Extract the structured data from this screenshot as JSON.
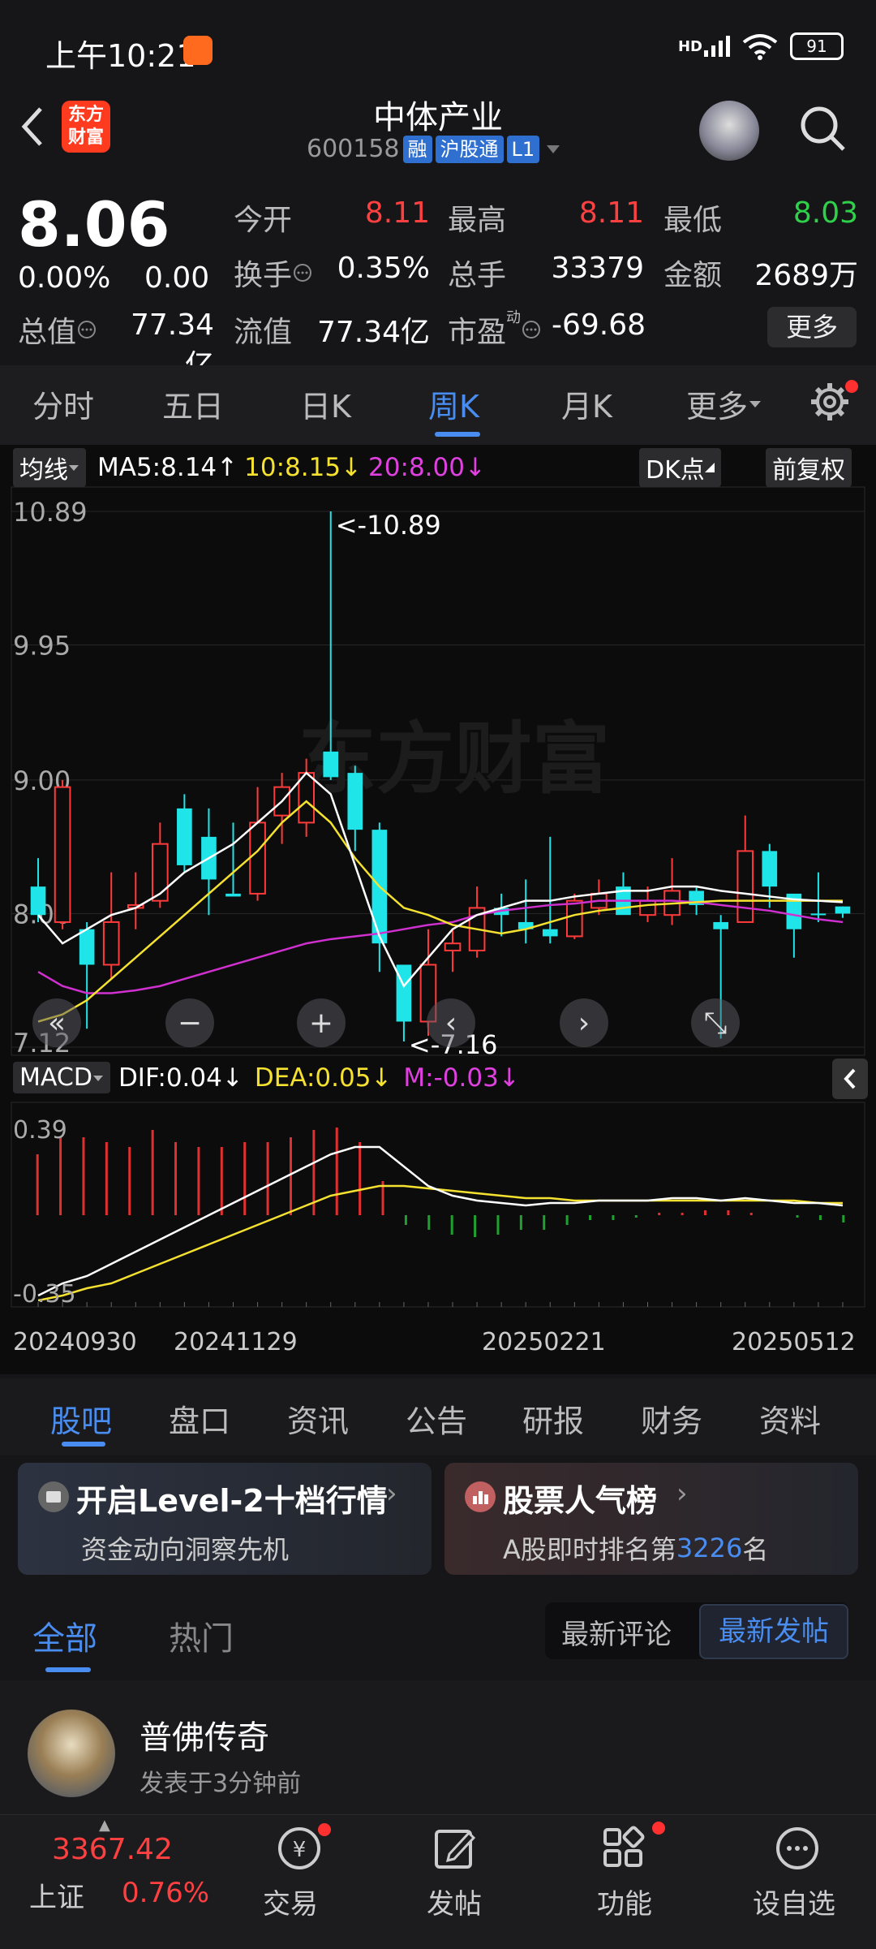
{
  "status": {
    "time": "上午10:21",
    "network": "HD",
    "battery": "91"
  },
  "header": {
    "logo_top": "东方",
    "logo_bottom": "财富",
    "title": "中体产业",
    "code": "600158",
    "tags": [
      "融",
      "沪股通",
      "L1"
    ]
  },
  "quote": {
    "price": "8.06",
    "change_pct": "0.00%",
    "change_val": "0.00",
    "open_label": "今开",
    "open": "8.11",
    "high_label": "最高",
    "high": "8.11",
    "low_label": "最低",
    "low": "8.03",
    "turnover_label": "换手",
    "turnover": "0.35%",
    "volume_label": "总手",
    "volume": "33379",
    "amount_label": "金额",
    "amount": "2689万",
    "mktcap_label": "总值",
    "mktcap": "77.34亿",
    "float_label": "流值",
    "float": "77.34亿",
    "pe_label": "市盈",
    "pe_sup": "动",
    "pe": "-69.68",
    "more": "更多"
  },
  "chart_tabs": [
    "分时",
    "五日",
    "日K",
    "周K",
    "月K",
    "更多"
  ],
  "ma_bar": {
    "selector": "均线",
    "ma5": "MA5:8.14",
    "ma10": "10:8.15",
    "ma20": "20:8.00",
    "dk": "DK点",
    "adjust": "前复权"
  },
  "chart_data": {
    "type": "candlestick",
    "price_axis_labels": [
      "10.89",
      "9.95",
      "9.00",
      "8.06",
      "7.12"
    ],
    "ylim": [
      7.12,
      10.89
    ],
    "annotations": [
      "<-10.89",
      "<-7.16"
    ],
    "watermark": "东方财富",
    "x_labels": [
      "20240930",
      "20241129",
      "20250221",
      "20250512"
    ],
    "candles": [
      {
        "o": 8.25,
        "h": 8.45,
        "l": 8.0,
        "c": 8.05
      },
      {
        "o": 8.0,
        "h": 9.0,
        "l": 7.95,
        "c": 8.95
      },
      {
        "o": 7.95,
        "h": 8.0,
        "l": 7.25,
        "c": 7.7
      },
      {
        "o": 7.7,
        "h": 8.35,
        "l": 7.6,
        "c": 8.0
      },
      {
        "o": 8.1,
        "h": 8.35,
        "l": 7.95,
        "c": 8.12
      },
      {
        "o": 8.15,
        "h": 8.7,
        "l": 8.1,
        "c": 8.55
      },
      {
        "o": 8.8,
        "h": 8.9,
        "l": 8.35,
        "c": 8.4
      },
      {
        "o": 8.6,
        "h": 8.8,
        "l": 8.05,
        "c": 8.3
      },
      {
        "o": 8.2,
        "h": 8.7,
        "l": 8.2,
        "c": 8.18
      },
      {
        "o": 8.2,
        "h": 8.95,
        "l": 8.15,
        "c": 8.7
      },
      {
        "o": 8.75,
        "h": 9.05,
        "l": 8.55,
        "c": 8.95
      },
      {
        "o": 8.7,
        "h": 9.15,
        "l": 8.6,
        "c": 9.05
      },
      {
        "o": 9.2,
        "h": 10.89,
        "l": 9.0,
        "c": 9.02
      },
      {
        "o": 9.05,
        "h": 9.1,
        "l": 8.5,
        "c": 8.65
      },
      {
        "o": 8.65,
        "h": 8.7,
        "l": 7.65,
        "c": 7.85
      },
      {
        "o": 7.7,
        "h": 7.7,
        "l": 7.16,
        "c": 7.3
      },
      {
        "o": 7.3,
        "h": 7.95,
        "l": 7.2,
        "c": 7.7
      },
      {
        "o": 7.8,
        "h": 7.95,
        "l": 7.65,
        "c": 7.85
      },
      {
        "o": 7.8,
        "h": 8.25,
        "l": 7.75,
        "c": 8.1
      },
      {
        "o": 8.1,
        "h": 8.2,
        "l": 7.9,
        "c": 8.05
      },
      {
        "o": 8.0,
        "h": 8.3,
        "l": 7.85,
        "c": 7.95
      },
      {
        "o": 7.95,
        "h": 8.6,
        "l": 7.85,
        "c": 7.9
      },
      {
        "o": 7.9,
        "h": 8.2,
        "l": 7.88,
        "c": 8.15
      },
      {
        "o": 8.1,
        "h": 8.3,
        "l": 8.05,
        "c": 8.2
      },
      {
        "o": 8.25,
        "h": 8.35,
        "l": 8.1,
        "c": 8.05
      },
      {
        "o": 8.05,
        "h": 8.25,
        "l": 8.0,
        "c": 8.15
      },
      {
        "o": 8.05,
        "h": 8.45,
        "l": 7.98,
        "c": 8.22
      },
      {
        "o": 8.22,
        "h": 8.25,
        "l": 8.05,
        "c": 8.12
      },
      {
        "o": 8.0,
        "h": 8.05,
        "l": 7.18,
        "c": 7.95
      },
      {
        "o": 8.0,
        "h": 8.75,
        "l": 8.3,
        "c": 8.5
      },
      {
        "o": 8.5,
        "h": 8.55,
        "l": 8.1,
        "c": 8.25
      },
      {
        "o": 8.2,
        "h": 8.15,
        "l": 7.75,
        "c": 7.95
      },
      {
        "o": 8.06,
        "h": 8.35,
        "l": 8.0,
        "c": 8.05
      },
      {
        "o": 8.11,
        "h": 8.11,
        "l": 8.03,
        "c": 8.06
      }
    ],
    "ma5": [
      8.05,
      7.85,
      7.95,
      8.05,
      8.1,
      8.2,
      8.35,
      8.45,
      8.55,
      8.7,
      8.85,
      9.05,
      8.9,
      8.4,
      7.9,
      7.55,
      7.75,
      7.95,
      8.05,
      8.1,
      8.15,
      8.15,
      8.18,
      8.2,
      8.22,
      8.22,
      8.25,
      8.25,
      8.22,
      8.2,
      8.18,
      8.16,
      8.15,
      8.14
    ],
    "ma10": [
      7.3,
      7.35,
      7.45,
      7.6,
      7.75,
      7.9,
      8.05,
      8.2,
      8.35,
      8.5,
      8.7,
      8.85,
      8.7,
      8.45,
      8.25,
      8.1,
      8.05,
      7.98,
      7.95,
      7.92,
      7.95,
      8.0,
      8.05,
      8.08,
      8.1,
      8.12,
      8.13,
      8.14,
      8.15,
      8.15,
      8.15,
      8.15,
      8.15,
      8.15
    ],
    "ma20": [
      7.65,
      7.55,
      7.5,
      7.5,
      7.52,
      7.55,
      7.6,
      7.65,
      7.7,
      7.75,
      7.8,
      7.85,
      7.88,
      7.9,
      7.92,
      7.95,
      7.98,
      8.0,
      8.05,
      8.08,
      8.1,
      8.12,
      8.13,
      8.15,
      8.15,
      8.15,
      8.15,
      8.14,
      8.12,
      8.1,
      8.08,
      8.05,
      8.02,
      8.0
    ],
    "macd": {
      "label": "MACD",
      "dif": "DIF:0.04",
      "dea": "DEA:0.05",
      "m": "M:-0.03",
      "axis_labels": [
        "0.39",
        "-0.35"
      ],
      "ylim": [
        -0.35,
        0.39
      ],
      "dif_line": [
        -0.33,
        -0.28,
        -0.25,
        -0.2,
        -0.15,
        -0.1,
        -0.05,
        0.0,
        0.05,
        0.1,
        0.15,
        0.2,
        0.25,
        0.28,
        0.28,
        0.2,
        0.12,
        0.08,
        0.06,
        0.05,
        0.04,
        0.05,
        0.05,
        0.06,
        0.06,
        0.06,
        0.07,
        0.07,
        0.06,
        0.07,
        0.06,
        0.05,
        0.05,
        0.04
      ],
      "dea_line": [
        -0.35,
        -0.33,
        -0.3,
        -0.28,
        -0.24,
        -0.2,
        -0.16,
        -0.12,
        -0.08,
        -0.04,
        0.0,
        0.04,
        0.08,
        0.1,
        0.12,
        0.12,
        0.11,
        0.1,
        0.09,
        0.08,
        0.07,
        0.07,
        0.06,
        0.06,
        0.06,
        0.06,
        0.06,
        0.06,
        0.06,
        0.06,
        0.06,
        0.06,
        0.05,
        0.05
      ],
      "hist": [
        0.25,
        0.32,
        0.32,
        0.3,
        0.28,
        0.35,
        0.3,
        0.28,
        0.28,
        0.3,
        0.3,
        0.32,
        0.35,
        0.36,
        0.3,
        0.14,
        -0.04,
        -0.06,
        -0.08,
        -0.09,
        -0.08,
        -0.06,
        -0.06,
        -0.04,
        -0.02,
        -0.02,
        -0.01,
        0.01,
        0.01,
        0.02,
        0.02,
        0.01,
        0.0,
        -0.01,
        -0.02,
        -0.03
      ]
    }
  },
  "info_tabs": [
    "股吧",
    "盘口",
    "资讯",
    "公告",
    "研报",
    "财务",
    "资料"
  ],
  "card_level2": {
    "title": "开启Level-2十档行情",
    "subtitle": "资金动向洞察先机"
  },
  "card_rank": {
    "title": "股票人气榜",
    "subtitle_prefix": "A股即时排名第",
    "rank": "3226",
    "subtitle_suffix": "名"
  },
  "filter": {
    "all": "全部",
    "hot": "热门",
    "latest_comment": "最新评论",
    "latest_post": "最新发帖"
  },
  "post": {
    "user": "普佛传奇",
    "time": "发表于3分钟前"
  },
  "bottom": {
    "index_value": "3367.42",
    "index_name": "上证",
    "index_change": "0.76%",
    "nav": [
      "交易",
      "发帖",
      "功能",
      "设自选"
    ]
  }
}
